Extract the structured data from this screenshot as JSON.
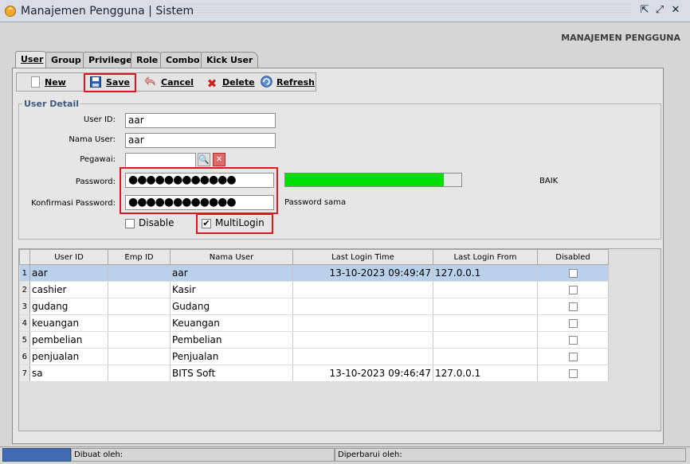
{
  "window": {
    "title": "Manajemen Pengguna | Sistem"
  },
  "page_label": "MANAJEMEN PENGGUNA",
  "tabs": [
    {
      "label": "User",
      "active": true
    },
    {
      "label": "Group"
    },
    {
      "label": "Privilege"
    },
    {
      "label": "Role"
    },
    {
      "label": "Combo"
    },
    {
      "label": "Kick User"
    }
  ],
  "toolbar": {
    "new_label": "New",
    "save_label": "Save",
    "cancel_label": "Cancel",
    "delete_label": "Delete",
    "refresh_label": "Refresh"
  },
  "user_detail": {
    "title": "User Detail",
    "user_id_label": "User ID:",
    "user_id_value": "aar",
    "nama_user_label": "Nama User:",
    "nama_user_value": "aar",
    "pegawai_label": "Pegawai:",
    "pegawai_value": "",
    "password_label": "Password:",
    "password_value": "●●●●●●●●●●●●",
    "password_strength": 0.9,
    "password_strength_text": "BAIK",
    "confirm_label": "Konfirmasi Password:",
    "confirm_value": "●●●●●●●●●●●●",
    "match_text": "Password sama",
    "disable_label": "Disable",
    "disable_checked": false,
    "multilogin_label": "MultiLogin",
    "multilogin_checked": true
  },
  "table": {
    "columns": [
      "User ID",
      "Emp ID",
      "Nama User",
      "Last Login Time",
      "Last Login From",
      "Disabled"
    ],
    "rows": [
      {
        "no": "1",
        "user_id": "aar",
        "emp_id": "",
        "nama": "aar",
        "last_time": "13-10-2023 09:49:47",
        "last_from": "127.0.0.1",
        "disabled": false,
        "selected": true
      },
      {
        "no": "2",
        "user_id": "cashier",
        "emp_id": "",
        "nama": "Kasir",
        "last_time": "",
        "last_from": "",
        "disabled": false
      },
      {
        "no": "3",
        "user_id": "gudang",
        "emp_id": "",
        "nama": "Gudang",
        "last_time": "",
        "last_from": "",
        "disabled": false
      },
      {
        "no": "4",
        "user_id": "keuangan",
        "emp_id": "",
        "nama": "Keuangan",
        "last_time": "",
        "last_from": "",
        "disabled": false
      },
      {
        "no": "5",
        "user_id": "pembelian",
        "emp_id": "",
        "nama": "Pembelian",
        "last_time": "",
        "last_from": "",
        "disabled": false
      },
      {
        "no": "6",
        "user_id": "penjualan",
        "emp_id": "",
        "nama": "Penjualan",
        "last_time": "",
        "last_from": "",
        "disabled": false
      },
      {
        "no": "7",
        "user_id": "sa",
        "emp_id": "",
        "nama": "BITS Soft",
        "last_time": "13-10-2023 09:46:47",
        "last_from": "127.0.0.1",
        "disabled": false
      }
    ]
  },
  "status": {
    "created_label": "Dibuat oleh:",
    "updated_label": "Diperbarui oleh:"
  },
  "colors": {
    "strength_bar": "#00e000",
    "highlight_box": "#e0161e",
    "selected_row": "#b9d1ea",
    "progress_segment": "#3e6bb2"
  }
}
